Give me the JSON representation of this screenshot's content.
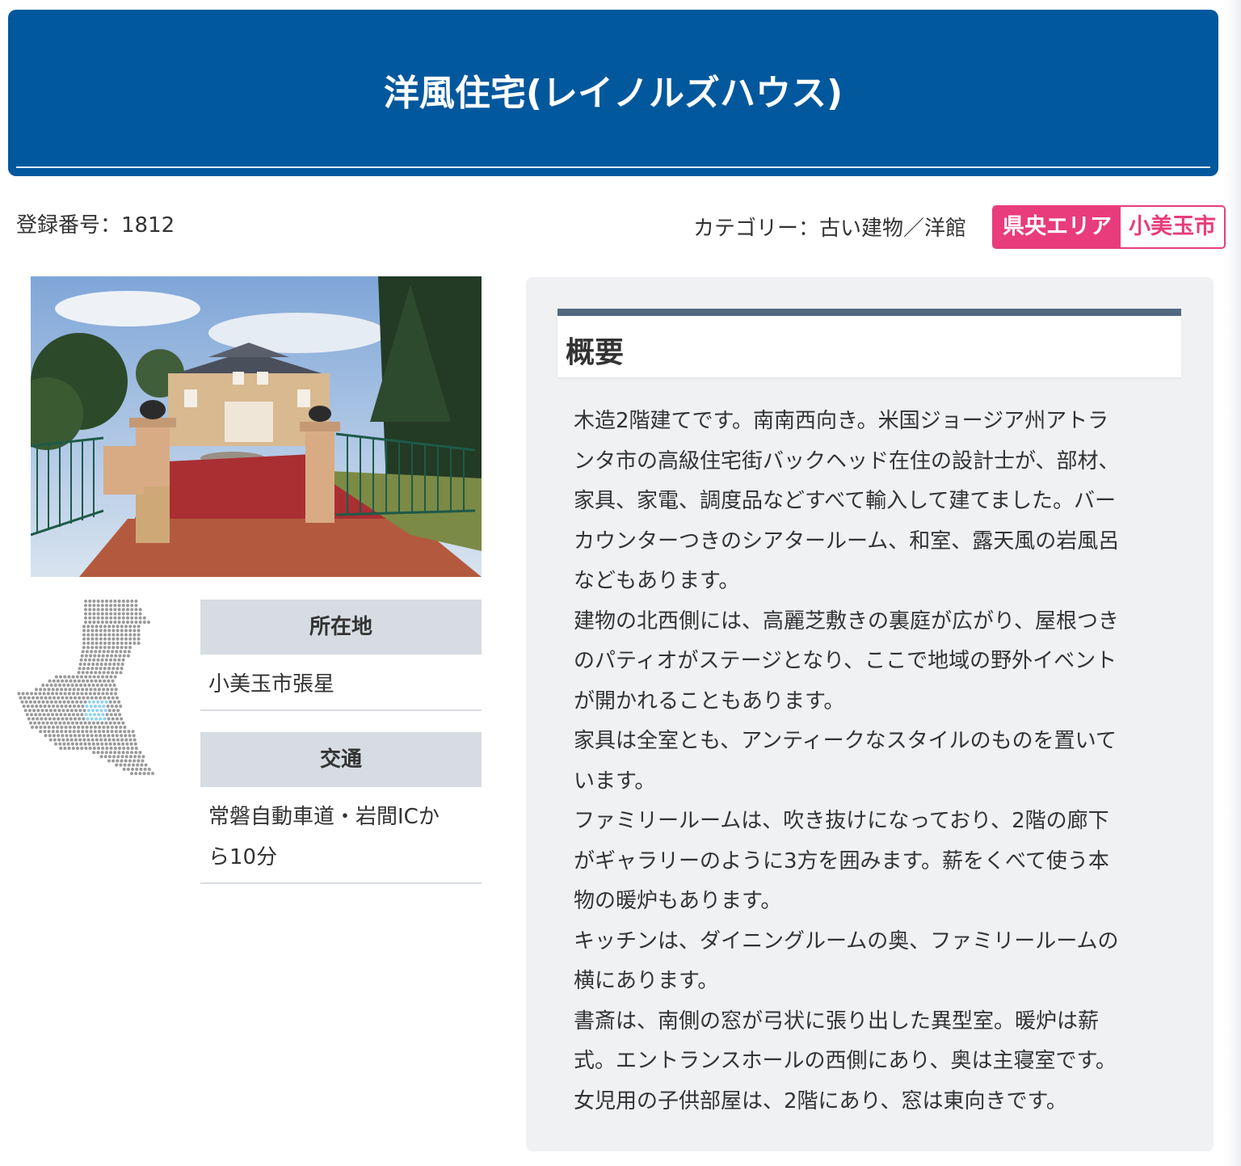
{
  "header": {
    "title": "洋風住宅(レイノルズハウス)"
  },
  "meta": {
    "registration": "登録番号：1812",
    "category": "カテゴリー：古い建物／洋館",
    "area_tag": "県央エリア",
    "city_tag": "小美玉市"
  },
  "info": {
    "location_label": "所在地",
    "location_value": "小美玉市張星",
    "access_label": "交通",
    "access_lines": [
      "常磐自動車道・岩間ICか",
      "ら10分"
    ]
  },
  "overview": {
    "title": "概要",
    "lines": [
      "木造2階建てです。南南西向き。米国ジョージア州アトラ",
      "ンタ市の高級住宅街バックヘッド在住の設計士が、部材、",
      "家具、家電、調度品などすべて輸入して建てました。バー",
      "カウンターつきのシアタールーム、和室、露天風の岩風呂",
      "などもあります。",
      "建物の北西側には、高麗芝敷きの裏庭が広がり、屋根つき",
      "のパティオがステージとなり、ここで地域の野外イベント",
      "が開かれることもあります。",
      "家具は全室とも、アンティークなスタイルのものを置いて",
      "います。",
      "ファミリールームは、吹き抜けになっており、2階の廊下",
      "がギャラリーのように3方を囲みます。薪をくべて使う本",
      "物の暖炉もあります。",
      "キッチンは、ダイニングルームの奥、ファミリールームの",
      "横にあります。",
      "書斎は、南側の窓が弓状に張り出した異型室。暖炉は薪",
      "式。エントランスホールの西側にあり、奥は主寝室です。",
      "女児用の子供部屋は、2階にあり、窓は東向きです。"
    ]
  },
  "colors": {
    "header_bg": "#02589d",
    "tag_pink": "#e83c7c",
    "panel_bg": "#eff1f3",
    "panel_bar": "#526a81",
    "map_dot": "#9a9a9a",
    "map_highlight": "#8fd3f0"
  }
}
